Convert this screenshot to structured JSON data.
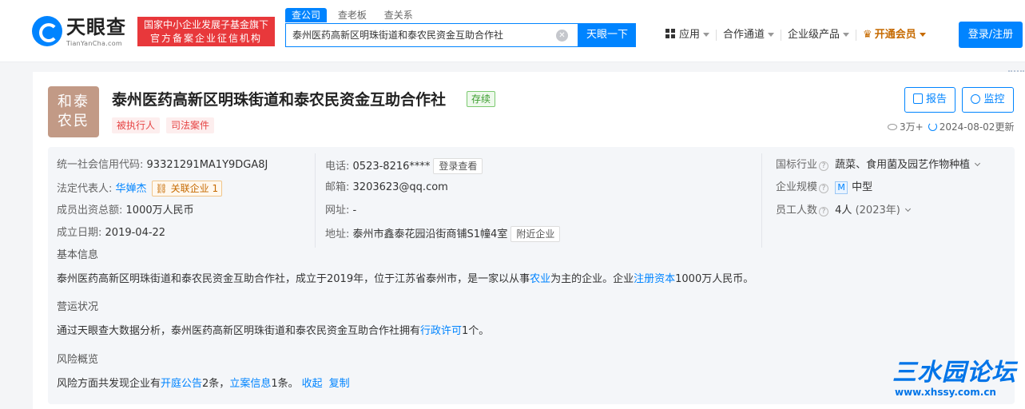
{
  "header": {
    "logo_text": "天眼查",
    "logo_sub": "TianYanCha.com",
    "badge_line1": "国家中小企业发展子基金旗下",
    "badge_line2": "官方备案企业征信机构",
    "tabs": [
      "查公司",
      "查老板",
      "查关系"
    ],
    "search_value": "泰州医药高新区明珠街道和泰农民资金互助合作社",
    "search_button": "天眼一下",
    "nav": [
      "应用",
      "合作通道",
      "企业级产品",
      "开通会员"
    ],
    "login": "登录/注册"
  },
  "company": {
    "avatar_line1": "和泰",
    "avatar_line2": "农民",
    "name": "泰州医药高新区明珠街道和泰农民资金互助合作社",
    "status": "存续",
    "tags": [
      "被执行人",
      "司法案件"
    ],
    "report_button": "报告",
    "monitor_button": "监控",
    "views": "3万+",
    "updated": "2024-08-02更新"
  },
  "info": {
    "credit_code_label": "统一社会信用代码:",
    "credit_code": "93321291MA1Y9DGA8J",
    "legal_rep_label": "法定代表人:",
    "legal_rep": "华婵杰",
    "related_label": "关联企业",
    "related_count": "1",
    "capital_label": "成员出资总额:",
    "capital": "1000万人民币",
    "founded_label": "成立日期:",
    "founded": "2019-04-22",
    "phone_label": "电话:",
    "phone": "0523-8216****",
    "phone_btn": "登录查看",
    "email_label": "邮箱:",
    "email": "3203623@qq.com",
    "site_label": "网址:",
    "site": "-",
    "address_label": "地址:",
    "address": "泰州市鑫泰花园沿街商铺S1幢4室",
    "nearby_btn": "附近企业",
    "industry_label": "国标行业",
    "industry": "蔬菜、食用菌及园艺作物种植",
    "scale_label": "企业规模",
    "scale_badge": "M",
    "scale": "中型",
    "staff_label": "员工人数",
    "staff": "4人",
    "staff_year": "(2023年)"
  },
  "summary": {
    "basic_title": "基本信息",
    "basic_p1": "泰州医药高新区明珠街道和泰农民资金互助合作社，成立于2019年，位于江苏省泰州市，是一家以从事",
    "basic_link1": "农业",
    "basic_p2": "为主的企业。企业",
    "basic_link2": "注册资本",
    "basic_p3": "1000万人民币。",
    "ops_title": "营运状况",
    "ops_p1": "通过天眼查大数据分析，泰州医药高新区明珠街道和泰农民资金互助合作社拥有",
    "ops_link": "行政许可",
    "ops_p2": "1个。",
    "risk_title": "风险概览",
    "risk_p1": "风险方面共发现企业有",
    "risk_link1": "开庭公告",
    "risk_p2": "2条，",
    "risk_link2": "立案信息",
    "risk_p3": "1条。",
    "collapse": "收起",
    "copy": "复制"
  },
  "watermark": {
    "title": "三水园论坛",
    "url": "www.xhssy.com.cn"
  }
}
